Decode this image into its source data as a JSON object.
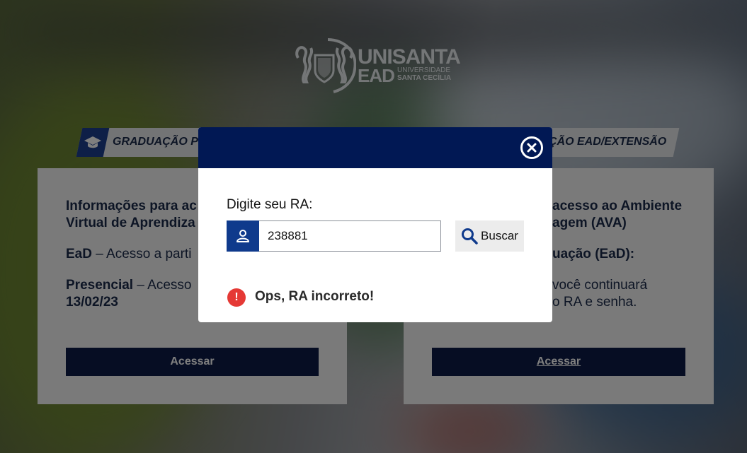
{
  "brand": {
    "name_line1": "UNISANTA",
    "name_line2": "EAD",
    "sub_line1": "UNIVERSIDADE",
    "sub_line2": "SANTA CECÍLIA"
  },
  "tabs": {
    "left": {
      "label": "GRADUAÇÃO P",
      "icon": "graduation-cap-icon"
    },
    "right": {
      "label": "ÇÃO EAD/EXTENSÃO"
    }
  },
  "cards": {
    "left": {
      "heading_line1": "Informações para ac",
      "heading_line2": "Virtual de Aprendiza",
      "ead_bold": "EaD",
      "ead_rest": " – Acesso a parti",
      "presencial_bold": "Presencial",
      "presencial_rest": " – Acesso",
      "date": "13/02/23",
      "button": "Acessar"
    },
    "right": {
      "heading_line1": "acesso ao Ambiente",
      "heading_line2": "agem (AVA)",
      "sub_bold": "uação (EaD):",
      "line1": "você continuará",
      "line2": "o RA e senha.",
      "button": "Acessar"
    }
  },
  "modal": {
    "label": "Digite seu RA:",
    "ra_value": "238881",
    "search_button": "Buscar",
    "error_message": "Ops, RA incorreto!",
    "colors": {
      "header": "#011854",
      "icon_box": "#0f3a8c",
      "error": "#e53935"
    }
  }
}
